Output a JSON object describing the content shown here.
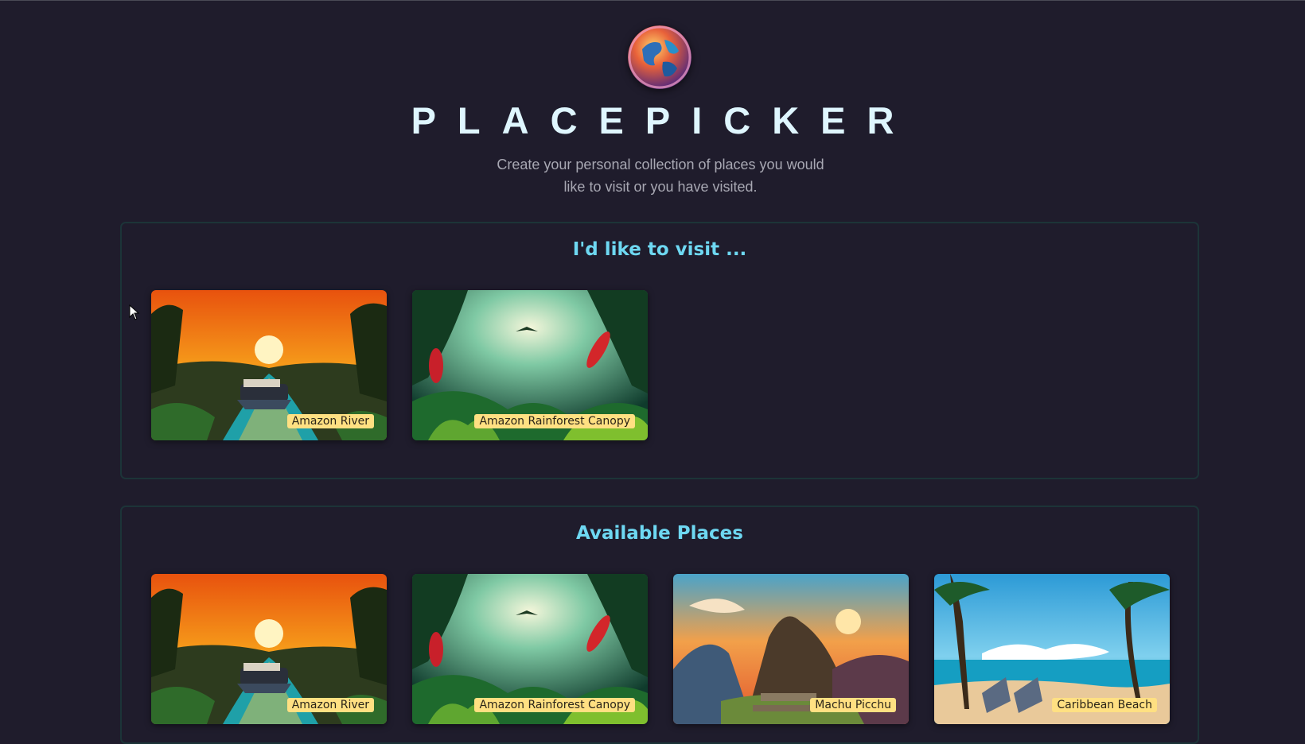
{
  "header": {
    "title": "PLACEPICKER",
    "subtitle": "Create your personal collection of places you would like to visit or you have visited.",
    "logo_icon": "globe-icon"
  },
  "visit_section": {
    "heading": "I'd like to visit ...",
    "places": [
      {
        "label": "Amazon River",
        "image": "amazon-river-image"
      },
      {
        "label": "Amazon Rainforest Canopy",
        "image": "rainforest-canopy-image"
      }
    ]
  },
  "available_section": {
    "heading": "Available Places",
    "places": [
      {
        "label": "Amazon River",
        "image": "amazon-river-image"
      },
      {
        "label": "Amazon Rainforest Canopy",
        "image": "rainforest-canopy-image"
      },
      {
        "label": "Machu Picchu",
        "image": "machu-picchu-image"
      },
      {
        "label": "Caribbean Beach",
        "image": "caribbean-beach-image"
      }
    ]
  },
  "colors": {
    "background": "#1f1c2c",
    "title": "#dff6ff",
    "heading": "#6ed8f2",
    "label_bg": "#ffe082",
    "section_border": "#1c3438"
  }
}
